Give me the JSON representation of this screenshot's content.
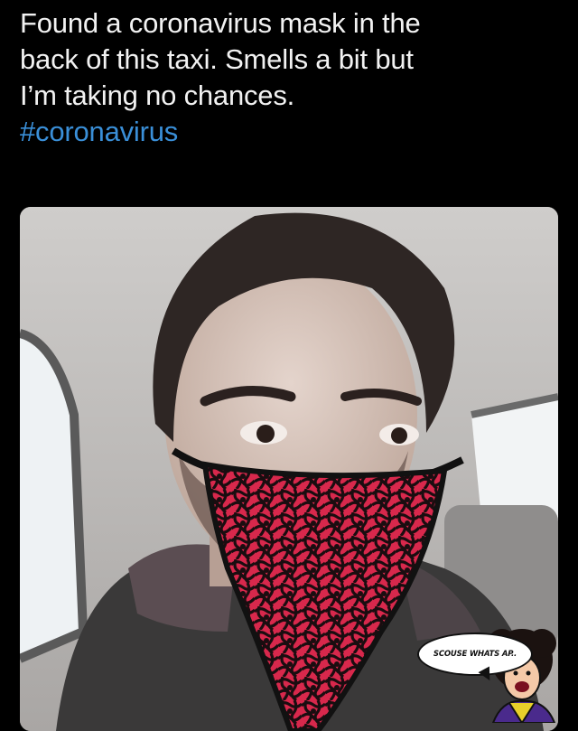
{
  "post": {
    "text_lines": [
      "Found a coronavirus mask in the",
      "back of this taxi. Smells a bit but",
      "I’m taking no chances."
    ],
    "hashtag": "#coronavirus"
  },
  "photo": {
    "subject": "selfie-in-taxi"
  },
  "sticker": {
    "speech_text": "SCOUSE WHATS AP.."
  },
  "colors": {
    "background": "#000000",
    "text": "#f2f2f2",
    "hashtag": "#3a8fd8",
    "mask_lace_red": "#d8284c",
    "mask_lace_black": "#1a0d10"
  }
}
